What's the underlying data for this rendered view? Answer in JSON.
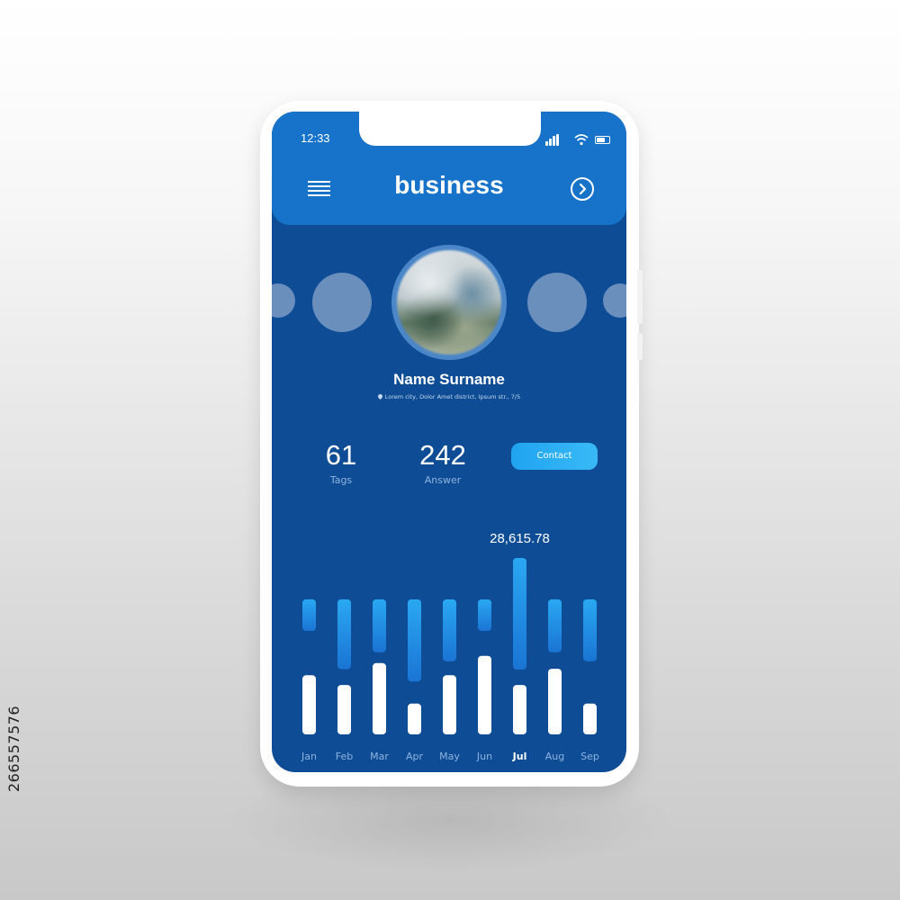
{
  "watermark_id": "266557576",
  "status_bar": {
    "time": "12:33"
  },
  "header": {
    "title": "business"
  },
  "profile": {
    "name": "Name Surname",
    "address": "Lorem city, Dolor Amet district, Ipsum str., 7/5"
  },
  "stats": [
    {
      "value": "61",
      "label": "Tags"
    },
    {
      "value": "242",
      "label": "Answer"
    }
  ],
  "contact_label": "Contact",
  "colors": {
    "screen_bg": "#0e4d95",
    "header_bg": "#1773c9",
    "accent": "#2aa8f2",
    "bar_white": "#ffffff"
  },
  "icons": [
    "menu-icon",
    "chevron-right-icon",
    "signal-icon",
    "wifi-icon",
    "battery-icon",
    "location-pin-icon"
  ],
  "chart_data": {
    "type": "bar",
    "categories": [
      "Jan",
      "Feb",
      "Mar",
      "Apr",
      "May",
      "Jun",
      "Jul",
      "Aug",
      "Sep"
    ],
    "highlighted": "Jul",
    "highlight_value": "28,615.78",
    "series": [
      {
        "values": [
          0.28,
          0.62,
          0.47,
          0.73,
          0.55,
          0.28,
          1.0,
          0.47,
          0.55
        ]
      },
      {
        "values": [
          0.73,
          0.61,
          0.88,
          0.38,
          0.73,
          0.97,
          0.61,
          0.81,
          0.38
        ]
      }
    ]
  }
}
